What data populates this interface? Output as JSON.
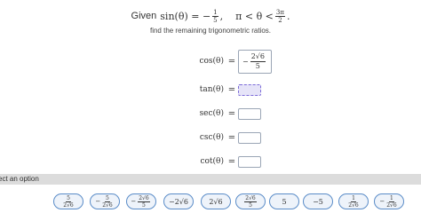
{
  "given": {
    "label": "Given",
    "expr_left": "sin(θ) = −",
    "sin_num": "1",
    "sin_den": "5",
    "cond_left": ",    π < θ <",
    "bound_num": "3π",
    "bound_den": "2",
    "cond_end": "."
  },
  "instruction": "find the remaining trigonometric ratios.",
  "rows": [
    {
      "name": "cos(θ)",
      "eq": "=",
      "value_sign": "−",
      "value_num": "2√6",
      "value_den": "5"
    },
    {
      "name": "tan(θ)",
      "eq": "="
    },
    {
      "name": "sec(θ)",
      "eq": "="
    },
    {
      "name": "csc(θ)",
      "eq": "="
    },
    {
      "name": "cot(θ)",
      "eq": "="
    }
  ],
  "options_label": "ect an option",
  "chips": [
    {
      "sign": "",
      "num": "5",
      "den": "2√6"
    },
    {
      "sign": "−",
      "num": "5",
      "den": "2√6"
    },
    {
      "sign": "−",
      "num": "2√6",
      "den": "5"
    },
    {
      "text": "−2√6"
    },
    {
      "text": "2√6"
    },
    {
      "sign": "",
      "num": "2√6",
      "den": "5"
    },
    {
      "text": "5"
    },
    {
      "text": "−5"
    },
    {
      "sign": "",
      "num": "1",
      "den": "2√6"
    },
    {
      "sign": "−",
      "num": "1",
      "den": "2√6"
    }
  ]
}
